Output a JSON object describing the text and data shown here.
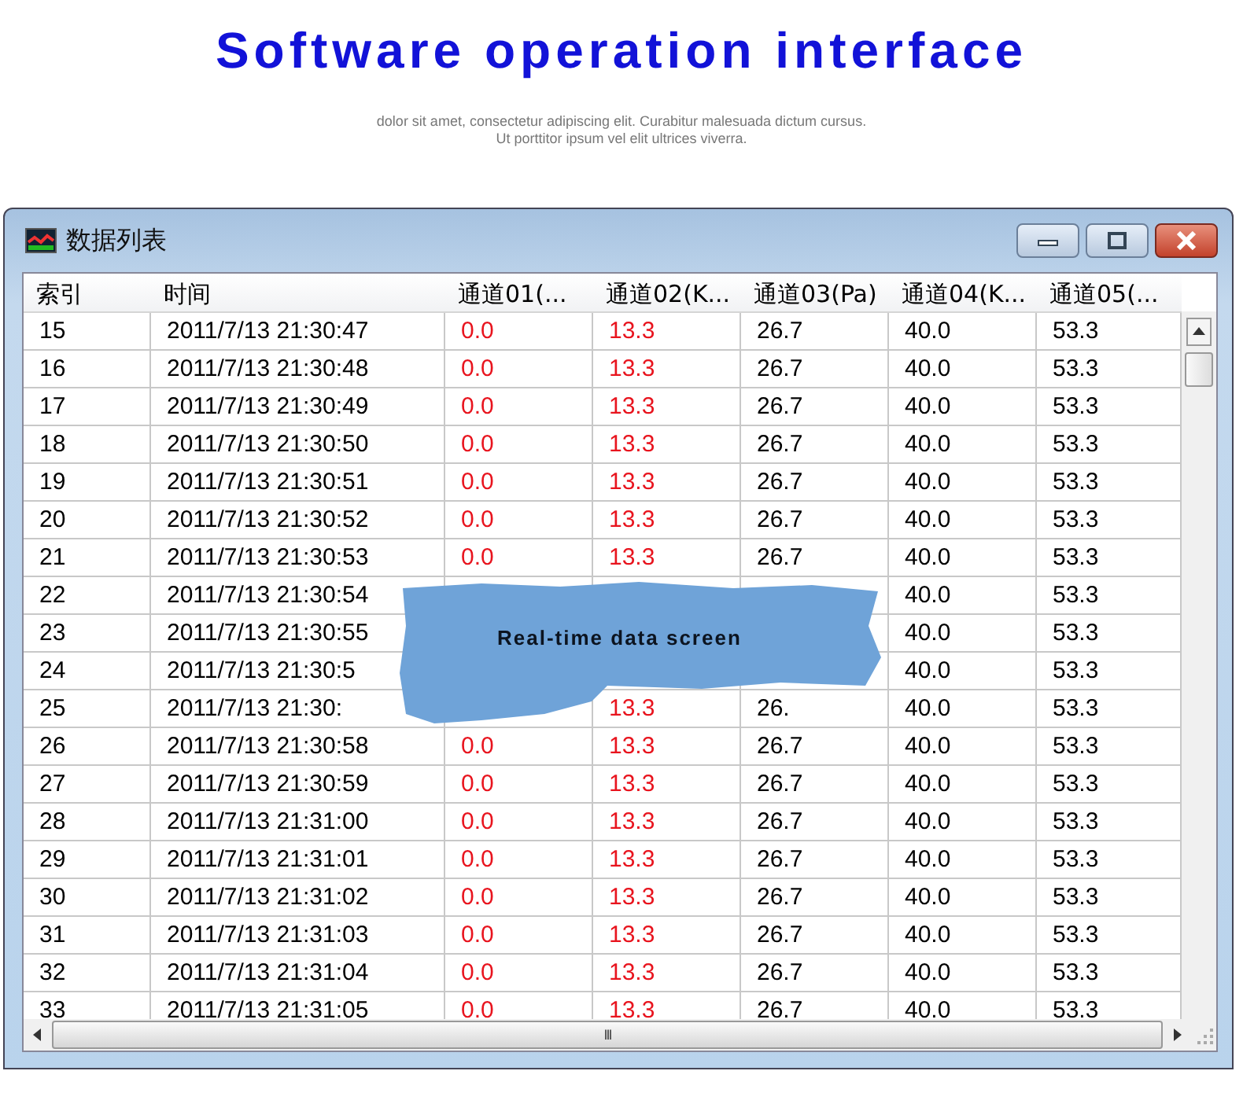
{
  "heading": "Software operation interface",
  "subtitle": [
    "dolor sit amet, consectetur adipiscing elit. Curabitur malesuada dictum cursus.",
    "Ut porttitor ipsum vel elit ultrices viverra."
  ],
  "window": {
    "title": "数据列表"
  },
  "table": {
    "columns": [
      {
        "label": "索引",
        "color": "#000000"
      },
      {
        "label": "时间",
        "color": "#000000"
      },
      {
        "label": "通道01(...",
        "color": "#e8141e"
      },
      {
        "label": "通道02(K...",
        "color": "#e8141e"
      },
      {
        "label": "通道03(Pa)",
        "color": "#000000"
      },
      {
        "label": "通道04(K...",
        "color": "#000000"
      },
      {
        "label": "通道05(...",
        "color": "#000000"
      }
    ],
    "rows": [
      {
        "cells": [
          "15",
          "2011/7/13 21:30:47",
          "0.0",
          "13.3",
          "26.7",
          "40.0",
          "53.3"
        ]
      },
      {
        "cells": [
          "16",
          "2011/7/13 21:30:48",
          "0.0",
          "13.3",
          "26.7",
          "40.0",
          "53.3"
        ]
      },
      {
        "cells": [
          "17",
          "2011/7/13 21:30:49",
          "0.0",
          "13.3",
          "26.7",
          "40.0",
          "53.3"
        ]
      },
      {
        "cells": [
          "18",
          "2011/7/13 21:30:50",
          "0.0",
          "13.3",
          "26.7",
          "40.0",
          "53.3"
        ]
      },
      {
        "cells": [
          "19",
          "2011/7/13 21:30:51",
          "0.0",
          "13.3",
          "26.7",
          "40.0",
          "53.3"
        ]
      },
      {
        "cells": [
          "20",
          "2011/7/13 21:30:52",
          "0.0",
          "13.3",
          "26.7",
          "40.0",
          "53.3"
        ]
      },
      {
        "cells": [
          "21",
          "2011/7/13 21:30:53",
          "0.0",
          "13.3",
          "26.7",
          "40.0",
          "53.3"
        ]
      },
      {
        "cells": [
          "22",
          "2011/7/13 21:30:54",
          null,
          null,
          null,
          "40.0",
          "53.3"
        ]
      },
      {
        "cells": [
          "23",
          "2011/7/13 21:30:55",
          null,
          null,
          null,
          "40.0",
          "53.3"
        ]
      },
      {
        "cells": [
          "24",
          "2011/7/13 21:30:5",
          null,
          null,
          null,
          "40.0",
          "53.3"
        ]
      },
      {
        "cells": [
          "25",
          "2011/7/13 21:30:",
          null,
          "13.3",
          "26.",
          "40.0",
          "53.3"
        ]
      },
      {
        "cells": [
          "26",
          "2011/7/13 21:30:58",
          "0.0",
          "13.3",
          "26.7",
          "40.0",
          "53.3"
        ]
      },
      {
        "cells": [
          "27",
          "2011/7/13 21:30:59",
          "0.0",
          "13.3",
          "26.7",
          "40.0",
          "53.3"
        ]
      },
      {
        "cells": [
          "28",
          "2011/7/13 21:31:00",
          "0.0",
          "13.3",
          "26.7",
          "40.0",
          "53.3"
        ]
      },
      {
        "cells": [
          "29",
          "2011/7/13 21:31:01",
          "0.0",
          "13.3",
          "26.7",
          "40.0",
          "53.3"
        ]
      },
      {
        "cells": [
          "30",
          "2011/7/13 21:31:02",
          "0.0",
          "13.3",
          "26.7",
          "40.0",
          "53.3"
        ]
      },
      {
        "cells": [
          "31",
          "2011/7/13 21:31:03",
          "0.0",
          "13.3",
          "26.7",
          "40.0",
          "53.3"
        ]
      },
      {
        "cells": [
          "32",
          "2011/7/13 21:31:04",
          "0.0",
          "13.3",
          "26.7",
          "40.0",
          "53.3"
        ]
      },
      {
        "cells": [
          "33",
          "2011/7/13 21:31:05",
          "0.0",
          "13.3",
          "26.7",
          "40.0",
          "53.3"
        ]
      }
    ]
  },
  "overlay": {
    "label": "Real-time data screen"
  },
  "scrollbar_grip": "III"
}
